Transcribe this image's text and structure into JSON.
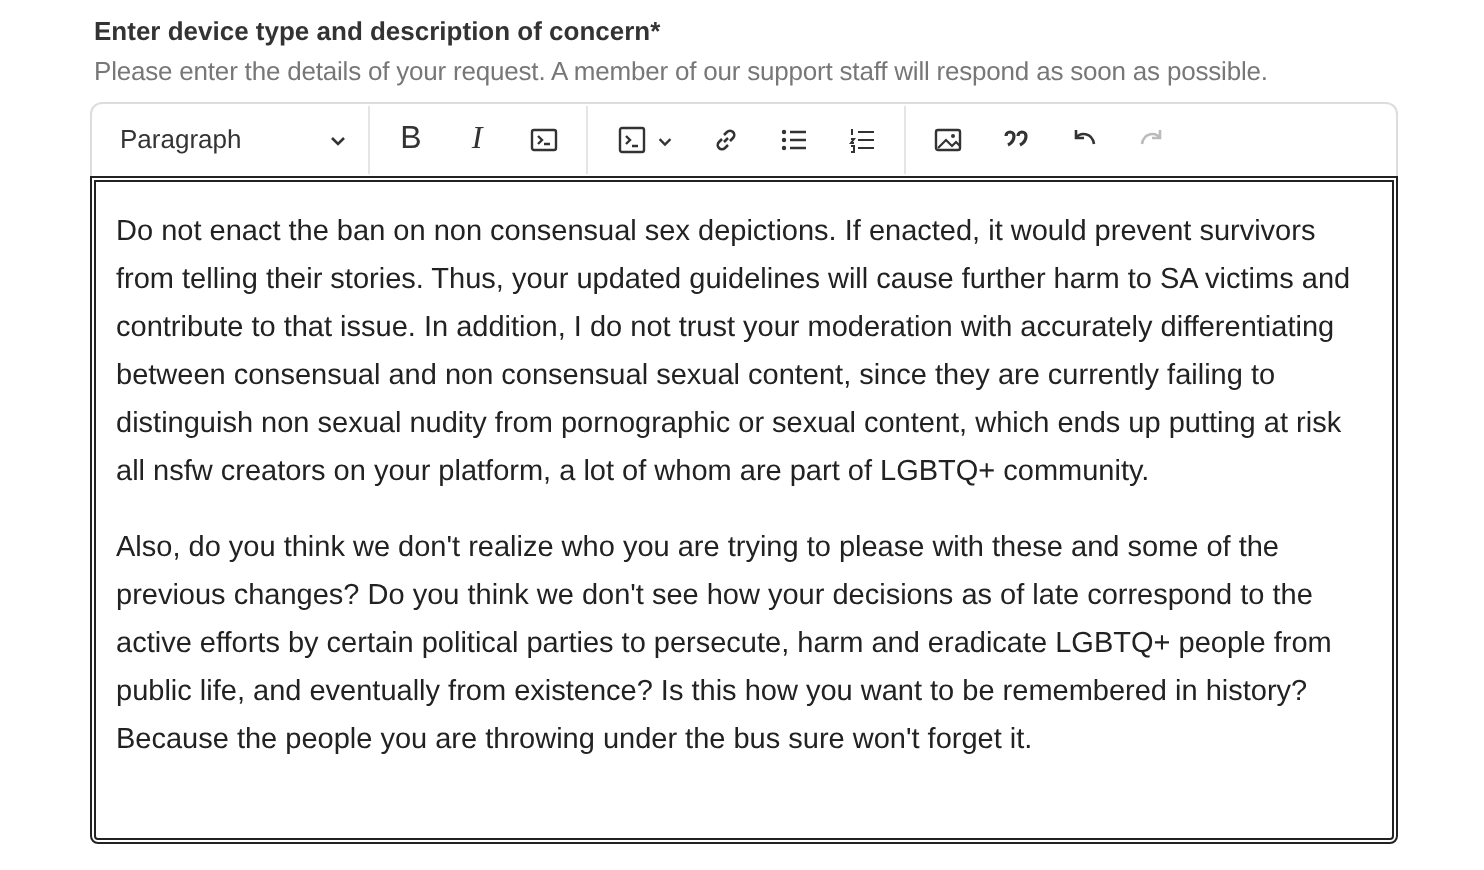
{
  "field": {
    "label": "Enter device type and description of concern*",
    "help": "Please enter the details of your request. A member of our support staff will respond as soon as possible."
  },
  "toolbar": [
    {
      "kind": "dropdown",
      "label": "Paragraph"
    },
    {
      "kind": "separator"
    },
    {
      "kind": "bold",
      "label": "B"
    },
    {
      "kind": "italic",
      "label": "I"
    },
    {
      "kind": "code"
    },
    {
      "kind": "separator"
    },
    {
      "kind": "code-block"
    },
    {
      "kind": "link"
    },
    {
      "kind": "bullet-list"
    },
    {
      "kind": "numbered-list"
    },
    {
      "kind": "separator"
    },
    {
      "kind": "image"
    },
    {
      "kind": "quote"
    },
    {
      "kind": "undo",
      "disabled": false
    },
    {
      "kind": "redo",
      "disabled": true
    }
  ],
  "editor": {
    "focused": true,
    "paragraphs": [
      "Do not enact the ban on non consensual sex depictions. If enacted, it would prevent survivors from telling their stories. Thus, your updated guidelines will cause further harm to SA victims and contribute to that issue. In addition, I do not trust your moderation with accurately differentiating between consensual and non consensual sexual content, since they are currently failing to distinguish non sexual nudity from pornographic or sexual content, which ends up putting at risk all nsfw creators on your platform, a lot of whom are part of LGBTQ+ community.",
      "Also, do you think we don't realize who you are trying to please with these and some of the previous changes? Do you think we don't see how your decisions as of late correspond to the active efforts by certain political parties to persecute, harm and eradicate LGBTQ+ people from public life, and eventually from existence? Is this how you want to be remembered in history? Because the people you are throwing under the bus sure won't forget it."
    ]
  }
}
